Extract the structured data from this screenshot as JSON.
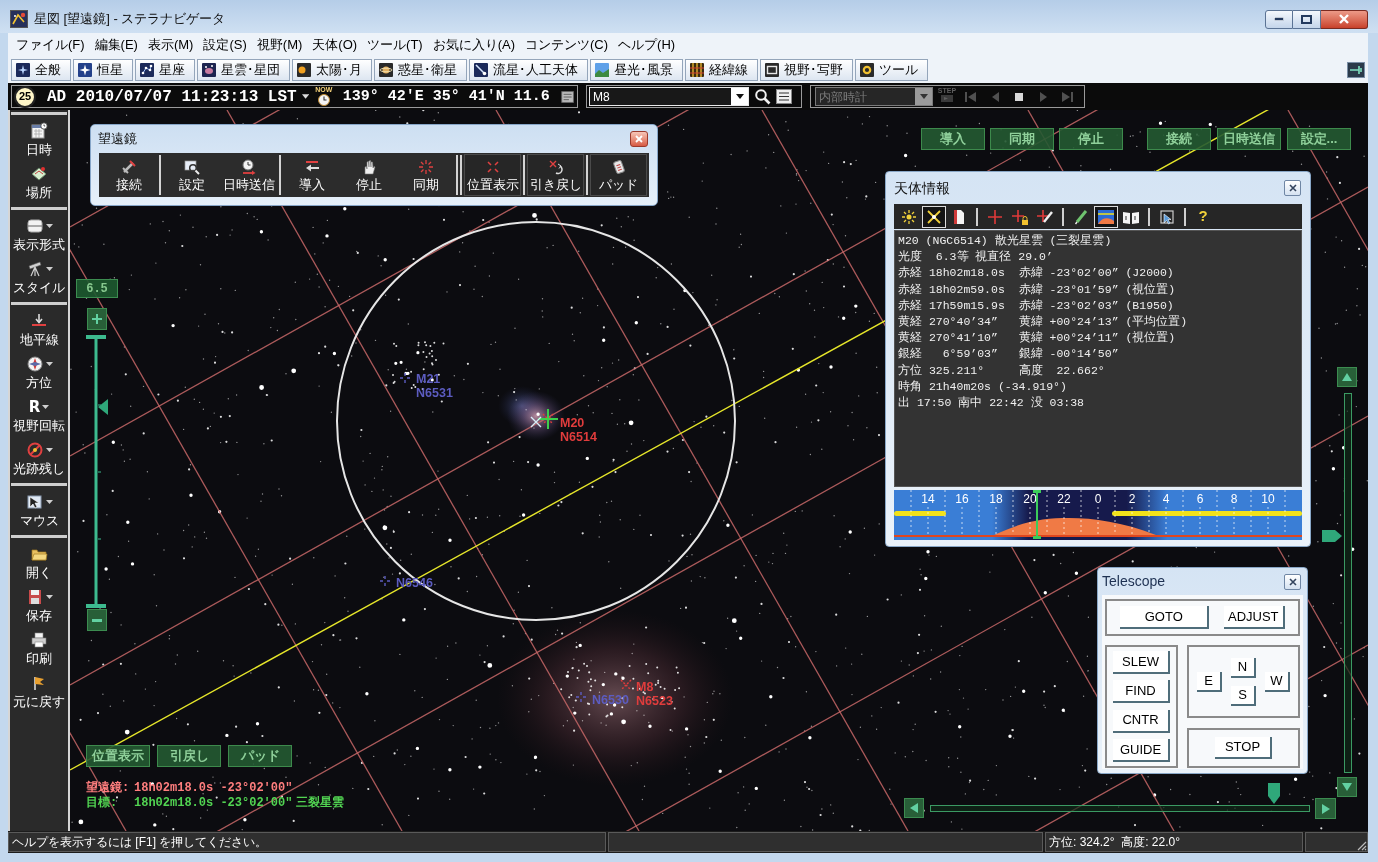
{
  "window": {
    "title": "星図 [望遠鏡] - ステラナビゲータ"
  },
  "menu": [
    "ファイル(F)",
    "編集(E)",
    "表示(M)",
    "設定(S)",
    "視野(M)",
    "天体(O)",
    "ツール(T)",
    "お気に入り(A)",
    "コンテンツ(C)",
    "ヘルプ(H)"
  ],
  "category_tabs": [
    "全般",
    "恒星",
    "星座",
    "星雲･星団",
    "太陽･月",
    "惑星･衛星",
    "流星･人工天体",
    "昼光･風景",
    "経緯線",
    "視野･写野",
    "ツール"
  ],
  "time_bar": {
    "moon_age": "25",
    "datetime": "AD 2010/07/07 11:23:13 LST",
    "now_label": "NOW",
    "location": "139° 42'E 35° 41'N 11.6",
    "search": {
      "value": "M8"
    },
    "clock_source": {
      "value": "内部時計",
      "disabled": true
    },
    "step_label": "STEP",
    "playback_disabled": true
  },
  "sidebar": {
    "groups": [
      {
        "items": [
          {
            "label": "日時",
            "menu": false
          },
          {
            "label": "場所",
            "menu": false
          }
        ]
      },
      {
        "items": [
          {
            "label": "表示形式",
            "menu": true
          },
          {
            "label": "スタイル",
            "menu": true
          }
        ]
      },
      {
        "items": [
          {
            "label": "地平線",
            "menu": false
          },
          {
            "label": "方位",
            "menu": true
          },
          {
            "label": "視野回転",
            "menu": true,
            "glyph": "R"
          },
          {
            "label": "光跡残し",
            "menu": true
          }
        ]
      },
      {
        "items": [
          {
            "label": "マウス",
            "menu": true
          }
        ]
      },
      {
        "items": [
          {
            "label": "開く",
            "menu": false
          },
          {
            "label": "保存",
            "menu": true
          },
          {
            "label": "印刷",
            "menu": false
          },
          {
            "label": "元に戻す",
            "menu": false
          }
        ]
      }
    ]
  },
  "telescope_toolbar": {
    "title": "望遠鏡",
    "groups": [
      {
        "buttons": [
          "接続"
        ]
      },
      {
        "buttons": [
          "設定",
          "日時送信"
        ]
      },
      {
        "buttons": [
          "導入",
          "停止",
          "同期"
        ]
      },
      {
        "buttons": [
          "位置表示"
        ]
      },
      {
        "buttons": [
          "引き戻し"
        ]
      },
      {
        "buttons": [
          "パッド"
        ]
      }
    ]
  },
  "sky": {
    "zoom": {
      "value": "6.5",
      "level": 0.74
    },
    "objects": [
      {
        "labels": [
          "M21",
          "N6531"
        ],
        "kind": "cluster",
        "color": "#5c5cc0",
        "targeted": false
      },
      {
        "labels": [
          "M20",
          "N6514"
        ],
        "kind": "nebula",
        "color": "#e03c3c",
        "targeted": true
      },
      {
        "labels": [
          "N6546"
        ],
        "kind": "cluster",
        "color": "#5c5cc0",
        "targeted": false
      },
      {
        "labels": [
          "M8",
          "N6523"
        ],
        "kind": "nebula",
        "color": "#e03c3c",
        "targeted": false
      },
      {
        "labels": [
          "N6530"
        ],
        "kind": "cluster",
        "color": "#5c5cc0",
        "targeted": false
      }
    ],
    "quick_buttons": [
      {
        "buttons": [
          "導入",
          "同期",
          "停止"
        ]
      },
      {
        "buttons": [
          "接続",
          "日時送信",
          "設定..."
        ]
      }
    ],
    "pad_buttons": [
      "位置表示",
      "引戻し",
      "パッド"
    ],
    "readouts": [
      {
        "kind": "telescope",
        "label": "望遠鏡:",
        "value": "18h02m18.0s -23°02'00\""
      },
      {
        "kind": "target",
        "label": "目標:",
        "value": "18h02m18.0s -23°02'00\"",
        "name": "三裂星雲"
      }
    ]
  },
  "object_info": {
    "title": "天体情報",
    "toolbar": [
      {
        "selected": false
      },
      {
        "selected": true
      },
      {
        "selected": false
      },
      {
        "selected": false
      },
      {
        "selected": false
      },
      {
        "selected": false
      },
      {
        "selected": false
      },
      {
        "selected": true
      },
      {
        "selected": false
      },
      {
        "selected": false
      },
      {
        "selected": false,
        "glyph": "?"
      }
    ],
    "lines": [
      "M20 (NGC6514) 散光星雲 (三裂星雲)",
      "光度  6.3等 視直径 29.0’",
      "赤経 18h02m18.0s  赤緯 -23°02’00” (J2000)",
      "赤経 18h02m59.0s  赤緯 -23°01’59” (視位置)",
      "赤経 17h59m15.9s  赤緯 -23°02’03” (B1950)",
      "黄経 270°40’34”   黄緯 +00°24’13” (平均位置)",
      "黄経 270°41’10”   黄緯 +00°24’11” (視位置)",
      "銀経   6°59’03”   銀緯 -00°14’50”",
      "方位 325.211°     高度  22.662°",
      "時角 21h40m20s (-34.919°)",
      "出 17:50 南中 22:42 没 03:38"
    ],
    "hour_labels": [
      "14",
      "16",
      "18",
      "20",
      "22",
      "0",
      "2",
      "4",
      "6",
      "8",
      "10"
    ]
  },
  "telescope_panel": {
    "title": "Telescope",
    "mode_buttons": [
      "GOTO",
      "ADJUST"
    ],
    "speed_buttons": [
      "SLEW",
      "FIND",
      "CNTR",
      "GUIDE"
    ],
    "direction_buttons": [
      "N",
      "E",
      "S",
      "W"
    ],
    "stop_button": "STOP"
  },
  "status_bar": {
    "help": "ヘルプを表示するには [F1] を押してください。",
    "position": "方位: 324.2°  高度: 22.0°"
  }
}
